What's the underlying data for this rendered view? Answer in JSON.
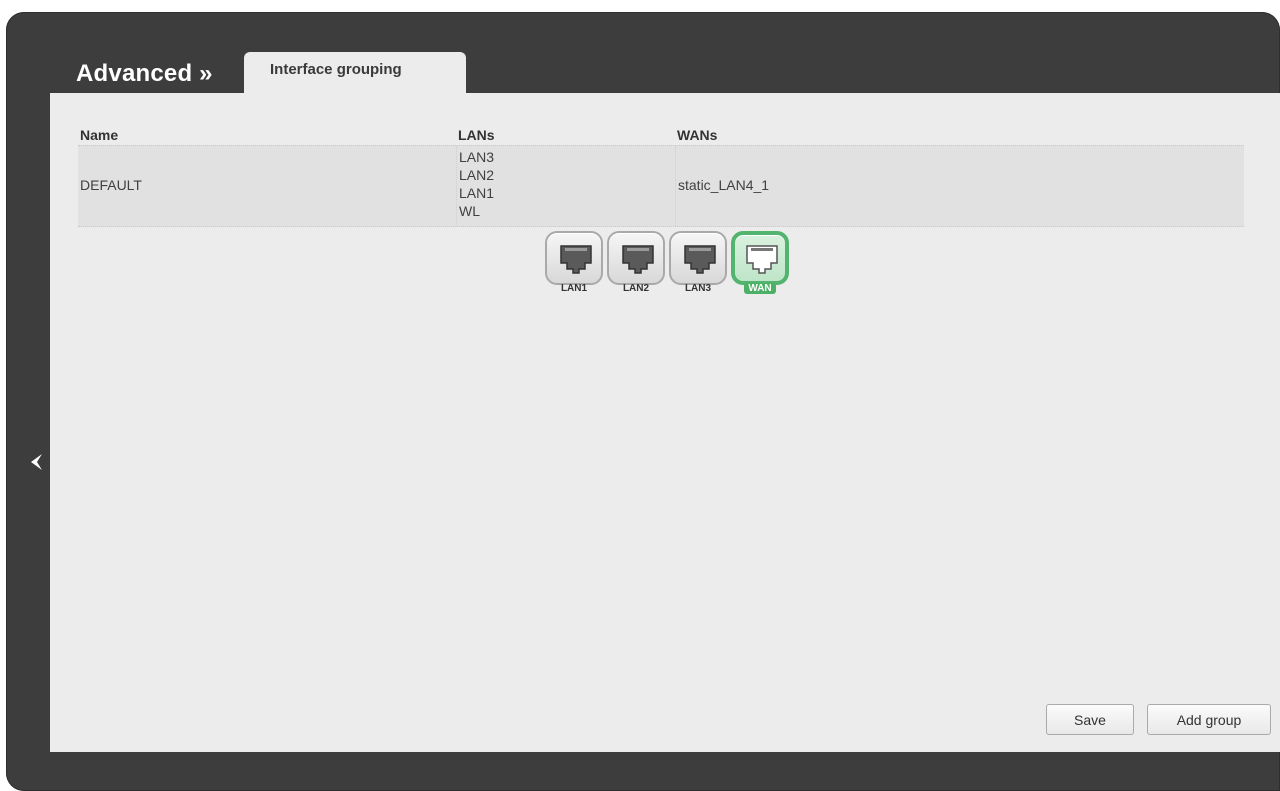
{
  "header": {
    "section": "Advanced »",
    "tab_label": "Interface grouping"
  },
  "table": {
    "columns": {
      "name": "Name",
      "lans": "LANs",
      "wans": "WANs"
    },
    "rows": [
      {
        "name": "DEFAULT",
        "lans": [
          "LAN3",
          "LAN2",
          "LAN1",
          "WL"
        ],
        "wans": "static_LAN4_1"
      }
    ]
  },
  "ports": [
    {
      "label": "LAN1",
      "state": "inactive"
    },
    {
      "label": "LAN2",
      "state": "inactive"
    },
    {
      "label": "LAN3",
      "state": "inactive"
    },
    {
      "label": "WAN",
      "state": "active"
    }
  ],
  "buttons": {
    "save": "Save",
    "add_group": "Add group"
  },
  "icons": {
    "back": "chevron-left-icon",
    "port": "ethernet-port-icon"
  },
  "colors": {
    "frame": "#3d3d3d",
    "panel": "#ececec",
    "wan_active": "#52b46e"
  }
}
